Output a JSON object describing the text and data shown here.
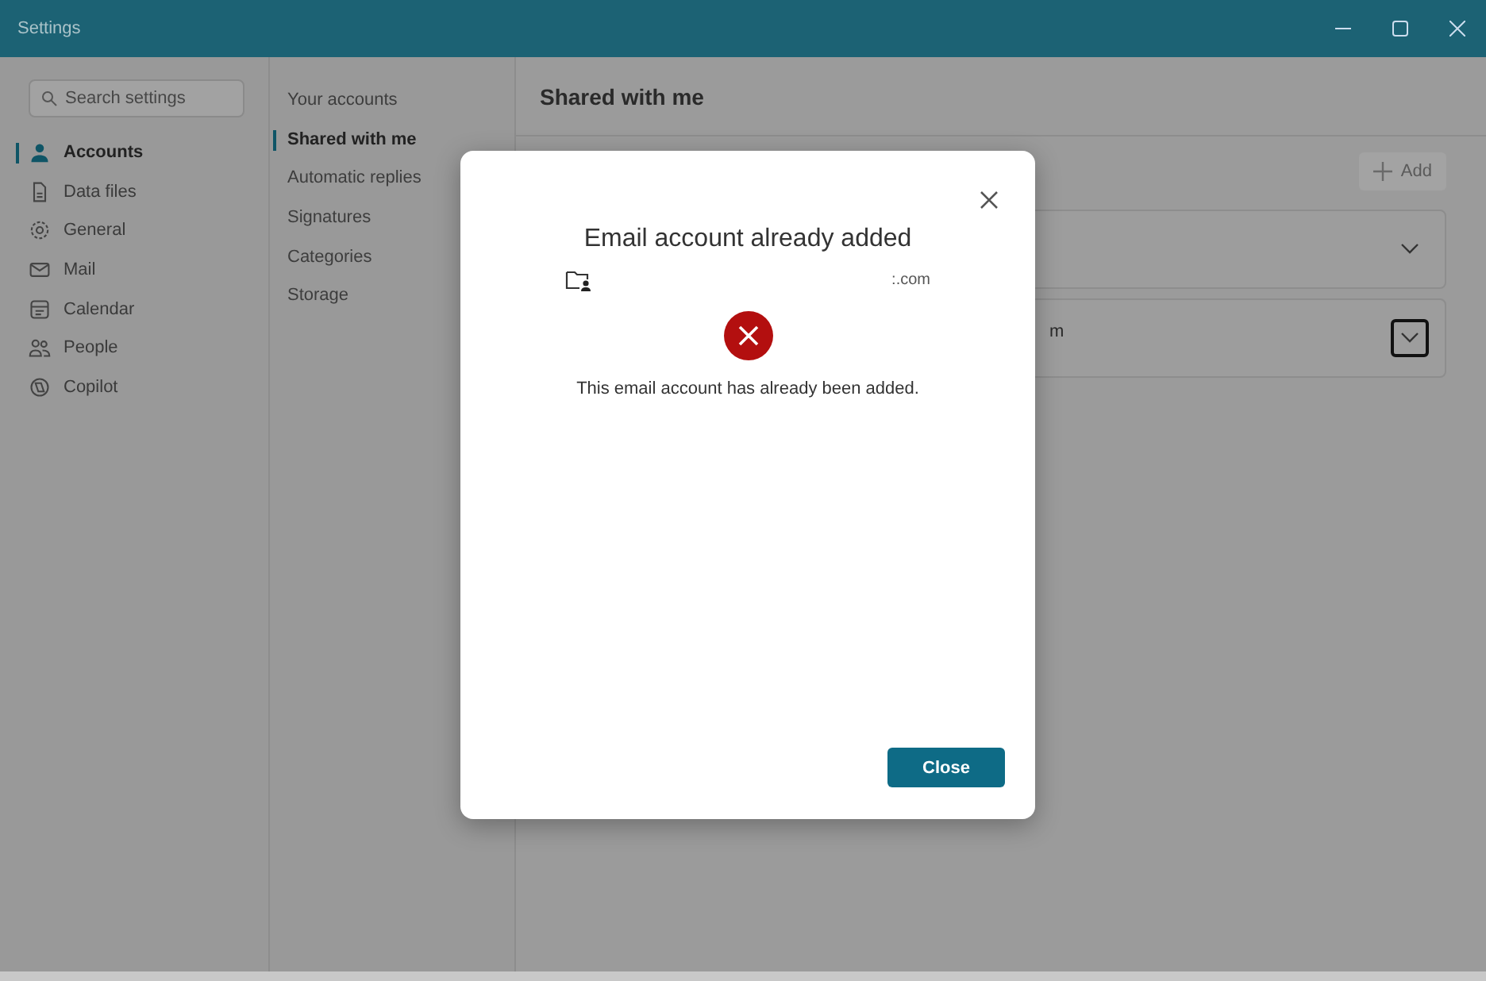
{
  "window": {
    "title": "Settings"
  },
  "search": {
    "placeholder": "Search settings"
  },
  "sidebar": {
    "items": [
      {
        "label": "Accounts",
        "selected": true
      },
      {
        "label": "Data files",
        "selected": false
      },
      {
        "label": "General",
        "selected": false
      },
      {
        "label": "Mail",
        "selected": false
      },
      {
        "label": "Calendar",
        "selected": false
      },
      {
        "label": "People",
        "selected": false
      },
      {
        "label": "Copilot",
        "selected": false
      }
    ]
  },
  "subnav": {
    "items": [
      {
        "label": "Your accounts",
        "selected": false
      },
      {
        "label": "Shared with me",
        "selected": true
      },
      {
        "label": "Automatic replies",
        "selected": false
      },
      {
        "label": "Signatures",
        "selected": false
      },
      {
        "label": "Categories",
        "selected": false
      },
      {
        "label": "Storage",
        "selected": false
      }
    ]
  },
  "main": {
    "heading": "Shared with me",
    "add_button": {
      "label": "Add",
      "disabled": true
    },
    "accounts": [
      {
        "focused": false
      },
      {
        "text": "m",
        "focused": true
      }
    ]
  },
  "dialog": {
    "title": "Email account already added",
    "account": ":.com",
    "message": "This email account has already been added.",
    "button": "Close"
  }
}
